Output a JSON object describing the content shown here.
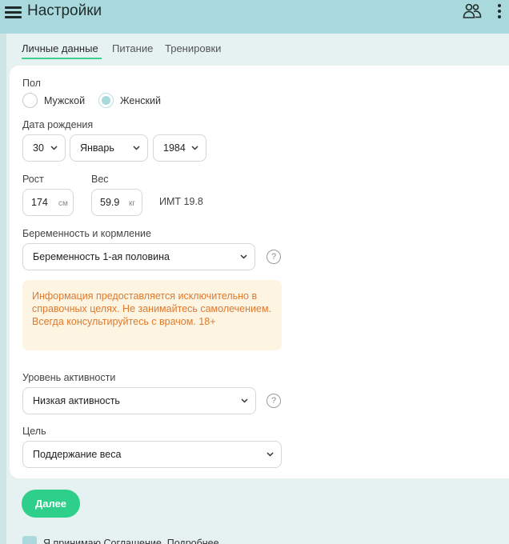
{
  "header": {
    "title": "Настройки",
    "menu_icon": "hamburger-menu-icon",
    "users_icon": "users-icon",
    "more_icon": "more-vertical-icon"
  },
  "tabs": [
    {
      "label": "Личные данные",
      "active": true
    },
    {
      "label": "Питание",
      "active": false
    },
    {
      "label": "Тренировки",
      "active": false
    }
  ],
  "form": {
    "gender": {
      "label": "Пол",
      "options": [
        {
          "label": "Мужской",
          "checked": false
        },
        {
          "label": "Женский",
          "checked": true
        }
      ]
    },
    "birthdate": {
      "label": "Дата рождения",
      "day": "30",
      "month": "Январь",
      "year": "1984"
    },
    "height": {
      "label": "Рост",
      "value": "174",
      "unit": "см"
    },
    "weight": {
      "label": "Вес",
      "value": "59.9",
      "unit": "кг"
    },
    "bmi_text": "ИМТ 19.8",
    "pregnancy": {
      "label": "Беременность и кормление",
      "value": "Беременность 1-ая половина"
    },
    "notice": "Информация предоставляется исключительно в справочных целях. Не занимайтесь самолечением. Всегда консультируйтесь с врачом. 18+",
    "activity": {
      "label": "Уровень активности",
      "value": "Низкая активность"
    },
    "goal": {
      "label": "Цель",
      "value": "Поддержание веса"
    },
    "help_symbol": "?"
  },
  "actions": {
    "next_label": "Далее",
    "agree_text": "Я принимаю Соглашение. Подробнее"
  },
  "colors": {
    "header_bg": "#a9d9dc",
    "page_bg": "#e6f1f1",
    "accent_green": "#2ecf8b",
    "notice_bg": "#fdf4e2",
    "notice_text": "#e07a2e"
  }
}
